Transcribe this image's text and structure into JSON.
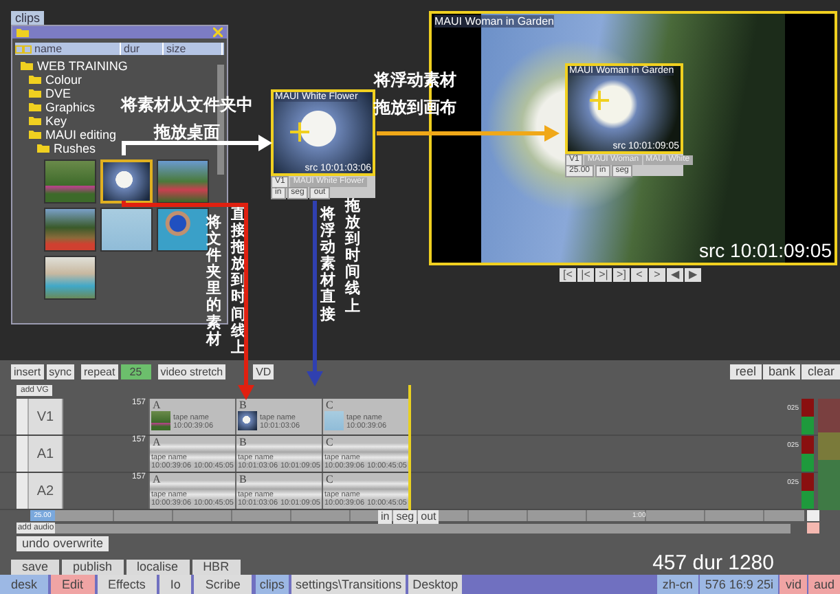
{
  "clips_panel": {
    "tab": "clips",
    "columns": [
      "name",
      "dur",
      "size"
    ],
    "tree": [
      {
        "label": "WEB TRAINING",
        "children": [
          {
            "label": "Colour"
          },
          {
            "label": "DVE"
          },
          {
            "label": "Graphics"
          },
          {
            "label": "Key"
          },
          {
            "label": "MAUI editing",
            "children": [
              {
                "label": "Rushes"
              }
            ]
          }
        ]
      }
    ],
    "thumbnails": [
      {
        "selected": false
      },
      {
        "selected": true
      },
      {
        "selected": false
      },
      {
        "selected": false
      },
      {
        "selected": false
      },
      {
        "selected": false
      },
      {
        "selected": false
      }
    ]
  },
  "floating_clip": {
    "title": "MAUI White Flower",
    "timecode": "src 10:01:03:06",
    "track": "V1",
    "clip": "MAUI White Flower",
    "buttons": [
      "in",
      "seg",
      "out"
    ]
  },
  "viewer": {
    "title": "MAUI Woman in Garden",
    "timecode": "src 10:01:09:05",
    "inset": {
      "title": "MAUI Woman in Garden",
      "timecode": "src 10:01:09:05",
      "track": "V1",
      "clips": [
        "MAUI Woman",
        "MAUI White"
      ],
      "rate": "25.00",
      "buttons": [
        "in",
        "seg"
      ]
    },
    "transport": [
      "[<",
      "|<",
      ">|",
      ">]",
      "<",
      ">",
      "◀",
      "▶"
    ]
  },
  "annotations": [
    {
      "kind": "horizontal",
      "lines": [
        "将素材从文件夹中",
        "拖放桌面"
      ]
    },
    {
      "kind": "horizontal",
      "lines": [
        "将浮动素材",
        "拖放到画布"
      ]
    },
    {
      "kind": "vertical",
      "lines": [
        "将文件夹里的素材",
        "直接拖放到时间线上"
      ]
    },
    {
      "kind": "vertical",
      "lines": [
        "将浮动素材直接",
        "拖放到时间线上"
      ]
    }
  ],
  "toolbar": [
    {
      "label": "insert",
      "on": false
    },
    {
      "label": "sync",
      "on": false
    },
    {
      "label": "repeat",
      "on": false
    },
    {
      "label": "25",
      "on": true
    },
    {
      "label": "video stretch",
      "on": false
    },
    {
      "label": "VD",
      "on": false
    }
  ],
  "bin_buttons": [
    "reel",
    "bank",
    "clear"
  ],
  "add_video": "add VG",
  "tracks": [
    {
      "name": "V1",
      "kind": "video",
      "number": "157",
      "clips": [
        {
          "name": "A",
          "tape": "tape name",
          "start": "10:00:39:06"
        },
        {
          "name": "B",
          "tape": "tape name",
          "start": "10:01:03:06"
        },
        {
          "name": "C",
          "tape": "tape name",
          "start": "10:00:39:06"
        }
      ]
    },
    {
      "name": "A1",
      "kind": "audio",
      "number": "157",
      "clips": [
        {
          "name": "A",
          "tape": "tape name",
          "start": "10:00:39:06",
          "end": "10:00:45:05"
        },
        {
          "name": "B",
          "tape": "tape name",
          "start": "10:01:03:06",
          "end": "10:01:09:05"
        },
        {
          "name": "C",
          "tape": "tape name",
          "start": "10:00:39:06",
          "end": "10:00:45:05"
        }
      ]
    },
    {
      "name": "A2",
      "kind": "audio",
      "number": "157",
      "clips": [
        {
          "name": "A",
          "tape": "tape name",
          "start": "10:00:39:06",
          "end": "10:00:45:05"
        },
        {
          "name": "B",
          "tape": "tape name",
          "start": "10:01:03:06",
          "end": "10:01:09:05"
        },
        {
          "name": "C",
          "tape": "tape name",
          "start": "10:00:39:06",
          "end": "10:00:45:05"
        }
      ]
    }
  ],
  "meter_labels": [
    "025",
    "025",
    "025"
  ],
  "rate": "25.00",
  "ruler_label": "1:00",
  "segment_buttons": [
    "in",
    "seg",
    "out"
  ],
  "add_audio": "add audio",
  "undo": "undo overwrite",
  "actions": [
    "save",
    "publish",
    "localise",
    "HBR"
  ],
  "duration": "457 dur 1280",
  "taskbar": {
    "left": [
      {
        "label": "desk",
        "color": "#9cb8e4"
      },
      {
        "label": "Edit",
        "color": "#f0a4a4"
      },
      {
        "label": "Effects",
        "color": "#dcdcdc"
      },
      {
        "label": "Io",
        "color": "#dcdcdc"
      },
      {
        "label": "Scribe",
        "color": "#dcdcdc"
      }
    ],
    "middle": [
      {
        "label": "clips",
        "color": "#9cb8e4"
      },
      {
        "label": "settings\\Transitions",
        "color": "#dcdcdc"
      },
      {
        "label": "Desktop",
        "color": "#dcdcdc"
      }
    ],
    "right": [
      {
        "label": "zh-cn",
        "color": "#9cb8e4"
      },
      {
        "label": "576 16:9 25i",
        "color": "#9cb8e4"
      },
      {
        "label": "vid",
        "color": "#f0a4a4"
      },
      {
        "label": "aud",
        "color": "#f0a4a4"
      }
    ]
  }
}
